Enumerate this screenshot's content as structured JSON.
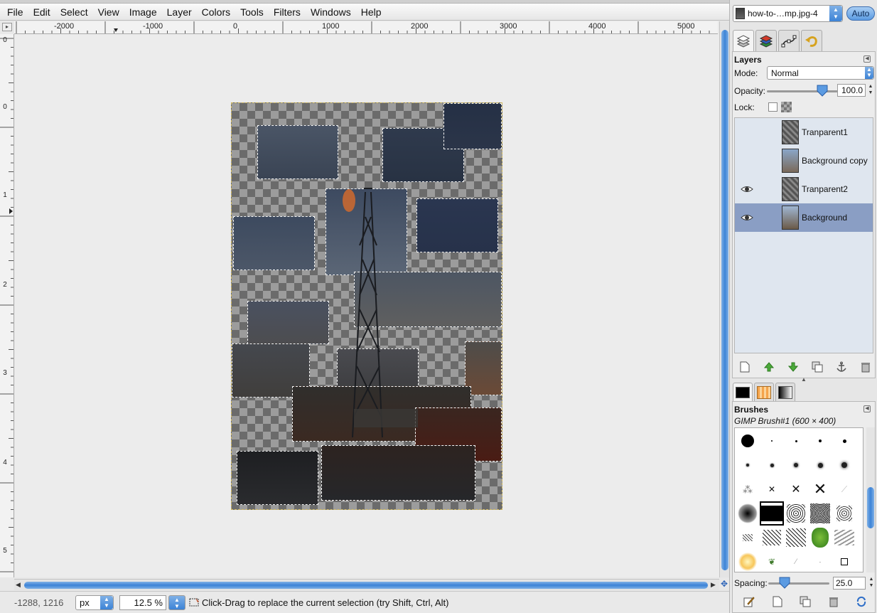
{
  "menubar": {
    "items": [
      "File",
      "Edit",
      "Select",
      "View",
      "Image",
      "Layer",
      "Colors",
      "Tools",
      "Filters",
      "Windows",
      "Help"
    ]
  },
  "rulers": {
    "horizontal_labels": [
      "-2000",
      "-1000",
      "0",
      "1000",
      "2000",
      "3000",
      "4000",
      "5000"
    ],
    "vertical_labels": [
      "0",
      "1",
      "2",
      "3",
      "4",
      "5"
    ]
  },
  "statusbar": {
    "coords": "-1288, 1216",
    "unit": "px",
    "zoom": "12.5 %",
    "message": "Click-Drag to replace the current selection (try Shift, Ctrl, Alt)"
  },
  "dock": {
    "image_select": "how-to-…mp.jpg-4",
    "auto_label": "Auto",
    "tab_icons": [
      "layers-icon",
      "channels-icon",
      "paths-icon",
      "undo-history-icon"
    ]
  },
  "layers": {
    "title": "Layers",
    "mode_label": "Mode:",
    "mode_value": "Normal",
    "opacity_label": "Opacity:",
    "opacity_value": "100.0",
    "lock_label": "Lock:",
    "items": [
      {
        "name": "Tranparent1",
        "visible": false,
        "selected": false
      },
      {
        "name": "Background copy",
        "visible": false,
        "selected": false
      },
      {
        "name": "Tranparent2",
        "visible": true,
        "selected": false
      },
      {
        "name": "Background",
        "visible": true,
        "selected": true
      }
    ],
    "buttons": [
      "new-layer-icon",
      "raise-layer-icon",
      "lower-layer-icon",
      "duplicate-layer-icon",
      "anchor-layer-icon",
      "delete-layer-icon"
    ]
  },
  "brushes": {
    "title": "Brushes",
    "current": "GIMP Brush#1 (600 × 400)",
    "spacing_label": "Spacing:",
    "spacing_value": "25.0",
    "buttons": [
      "edit-brush-icon",
      "new-brush-icon",
      "duplicate-brush-icon",
      "delete-brush-icon",
      "refresh-brushes-icon"
    ]
  },
  "colors": {
    "accent": "#3c83d6",
    "selected_layer": "#8a9ec4",
    "layer_list_bg": "#dfe6ef"
  }
}
